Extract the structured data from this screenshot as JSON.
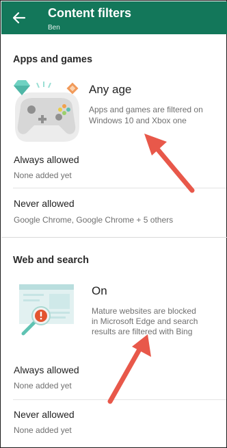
{
  "header": {
    "title": "Content filters",
    "subtitle": "Ben",
    "back_icon": "arrow-left-icon",
    "bg_color": "#13775a"
  },
  "apps": {
    "section_title": "Apps and games",
    "rating": "Any age",
    "description_line1": "Apps and games are filtered on",
    "description_line2": "Windows 10 and Xbox one",
    "always_allowed_label": "Always allowed",
    "always_allowed_value": "None added yet",
    "never_allowed_label": "Never allowed",
    "never_allowed_value": "Google Chrome, Google Chrome + 5 others",
    "icon": "gamepad-icon"
  },
  "web": {
    "section_title": "Web and search",
    "status": "On",
    "description_line1": "Mature websites are blocked",
    "description_line2": "in Microsoft Edge and search",
    "description_line3": "results are filtered with Bing",
    "always_allowed_label": "Always allowed",
    "always_allowed_value": "None added yet",
    "never_allowed_label": "Never allowed",
    "never_allowed_value": "None added yet",
    "icon": "browser-magnifier-warning-icon"
  },
  "annotation": {
    "arrow_color": "#e8584a"
  }
}
